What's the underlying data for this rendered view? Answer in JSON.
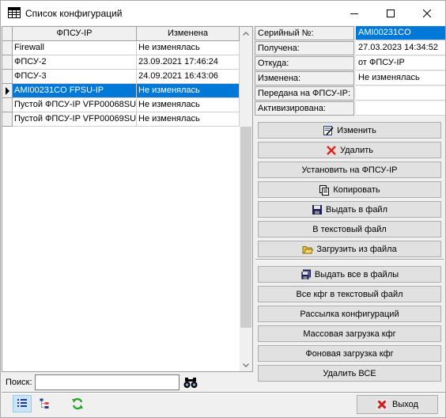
{
  "window": {
    "title": "Список конфигураций",
    "minimize_icon": "minimize-icon",
    "maximize_icon": "maximize-icon",
    "close_icon": "close-icon"
  },
  "grid": {
    "columns": [
      "ФПСУ-IP",
      "Изменена"
    ],
    "rows": [
      {
        "name": "Firewall",
        "changed": "Не изменялась"
      },
      {
        "name": "ФПСУ-2",
        "changed": "23.09.2021 17:46:24"
      },
      {
        "name": "ФПСУ-3",
        "changed": "24.09.2021 16:43:06"
      },
      {
        "name": "AMI00231CO FPSU-IP",
        "changed": "Не изменялась",
        "selected": true
      },
      {
        "name": "Пустой ФПСУ-IP VFP00068SU",
        "changed": "Не изменялась"
      },
      {
        "name": "Пустой ФПСУ-IP VFP00069SU",
        "changed": "Не изменялась"
      }
    ]
  },
  "properties": [
    {
      "label": "Серийный №:",
      "value": "AMI00231CO"
    },
    {
      "label": "Получена:",
      "value": "27.03.2023 14:34:52"
    },
    {
      "label": "Откуда:",
      "value": "от ФПСУ-IP"
    },
    {
      "label": "Изменена:",
      "value": "Не изменялась"
    },
    {
      "label": "Передана на ФПСУ-IP:",
      "value": ""
    },
    {
      "label": "Активизирована:",
      "value": ""
    }
  ],
  "actions": {
    "edit": "Изменить",
    "delete": "Удалить",
    "install": "Установить на ФПСУ-IP",
    "copy": "Копировать",
    "export_file": "Выдать в файл",
    "export_text": "В текстовый файл",
    "import_file": "Загрузить из файла",
    "export_all": "Выдать все в файлы",
    "export_all_text": "Все кфг в текстовый файл",
    "distribute": "Рассылка конфигураций",
    "bulk_load": "Массовая загрузка кфг",
    "background_load": "Фоновая загрузка кфг",
    "delete_all": "Удалить ВСЕ"
  },
  "search": {
    "label": "Поиск:",
    "value": "",
    "icon": "binoculars-icon"
  },
  "toolbar": {
    "list_view_icon": "list-view-icon",
    "tree_view_icon": "tree-view-icon",
    "refresh_icon": "refresh-icon"
  },
  "exit_label": "Выход",
  "colors": {
    "selection": "#0078d7",
    "delete_red": "#e0201b",
    "refresh_green": "#2aa52a"
  }
}
